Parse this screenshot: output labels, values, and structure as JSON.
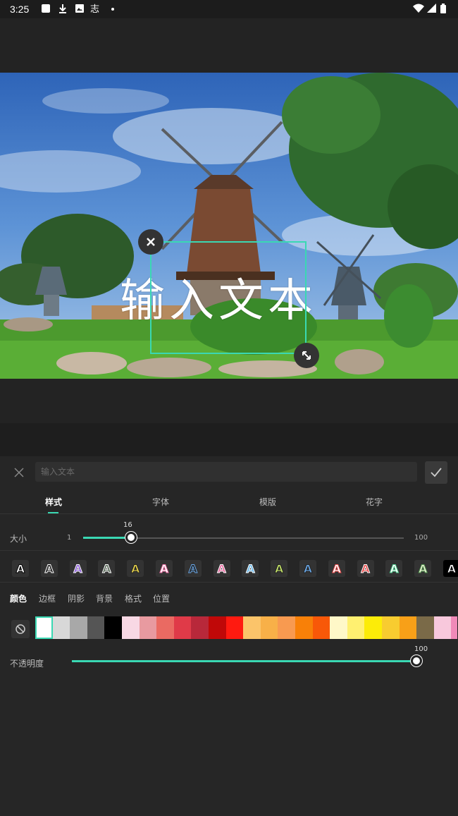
{
  "status_bar": {
    "time": "3:25"
  },
  "preview": {
    "overlay_text": "输入文本"
  },
  "editor": {
    "input_placeholder": "输入文本",
    "tabs": [
      {
        "label": "样式",
        "active": true
      },
      {
        "label": "字体",
        "active": false
      },
      {
        "label": "模版",
        "active": false
      },
      {
        "label": "花字",
        "active": false
      }
    ],
    "size": {
      "label": "大小",
      "min": "1",
      "max": "100",
      "value": "16"
    },
    "style_presets": [
      {
        "glyph": "A",
        "fill": "#ffffff",
        "stroke": "#000000"
      },
      {
        "glyph": "A",
        "fill": "#222222",
        "stroke": "#ffffff"
      },
      {
        "glyph": "A",
        "fill": "#8a5cd6",
        "stroke": "#ffffff"
      },
      {
        "glyph": "A",
        "fill": "#5a6a5a",
        "stroke": "#ffffff"
      },
      {
        "glyph": "A",
        "fill": "#e8d44a",
        "stroke": "#222222"
      },
      {
        "glyph": "A",
        "fill": "#ffffff",
        "stroke": "#e86aa0"
      },
      {
        "glyph": "A",
        "fill": "#222222",
        "stroke": "#6aa8e8"
      },
      {
        "glyph": "A",
        "fill": "#e86aa0",
        "stroke": "#ffffff"
      },
      {
        "glyph": "A",
        "fill": "#6ab8e8",
        "stroke": "#ffffff"
      },
      {
        "glyph": "A",
        "fill": "#c8e86a",
        "stroke": "#222222"
      },
      {
        "glyph": "A",
        "fill": "#6aa8e8",
        "stroke": "#222222"
      },
      {
        "glyph": "A",
        "fill": "#ffffff",
        "stroke": "#e84a4a"
      },
      {
        "glyph": "A",
        "fill": "#e84a4a",
        "stroke": "#ffffff"
      },
      {
        "glyph": "A",
        "fill": "#ffffff",
        "stroke": "#4ac88a"
      },
      {
        "glyph": "A",
        "fill": "#e8f0d0",
        "stroke": "#4a8a4a"
      },
      {
        "glyph": "A",
        "fill": "#ffffff",
        "stroke": "#000000"
      }
    ],
    "subtabs": [
      {
        "label": "颜色",
        "active": true
      },
      {
        "label": "边框",
        "active": false
      },
      {
        "label": "阴影",
        "active": false
      },
      {
        "label": "背景",
        "active": false
      },
      {
        "label": "格式",
        "active": false
      },
      {
        "label": "位置",
        "active": false
      }
    ],
    "swatches": [
      "#ffffff",
      "#d8d8d8",
      "#a8a8a8",
      "#555555",
      "#000000",
      "#f8d8e4",
      "#e89aa0",
      "#ea6a62",
      "#e03a48",
      "#b8283a",
      "#c00808",
      "#ff1a10",
      "#fbc46a",
      "#f8b048",
      "#f89a50",
      "#f88008",
      "#f85808",
      "#fff8c8",
      "#fff070",
      "#fcec08",
      "#f8cc30",
      "#f8a018",
      "#7a6a48",
      "#f8c8dc",
      "#f08ab8"
    ],
    "selected_swatch": "#ffffff",
    "opacity": {
      "label": "不透明度",
      "value": "100"
    }
  },
  "colors": {
    "accent": "#3ad8b3"
  }
}
